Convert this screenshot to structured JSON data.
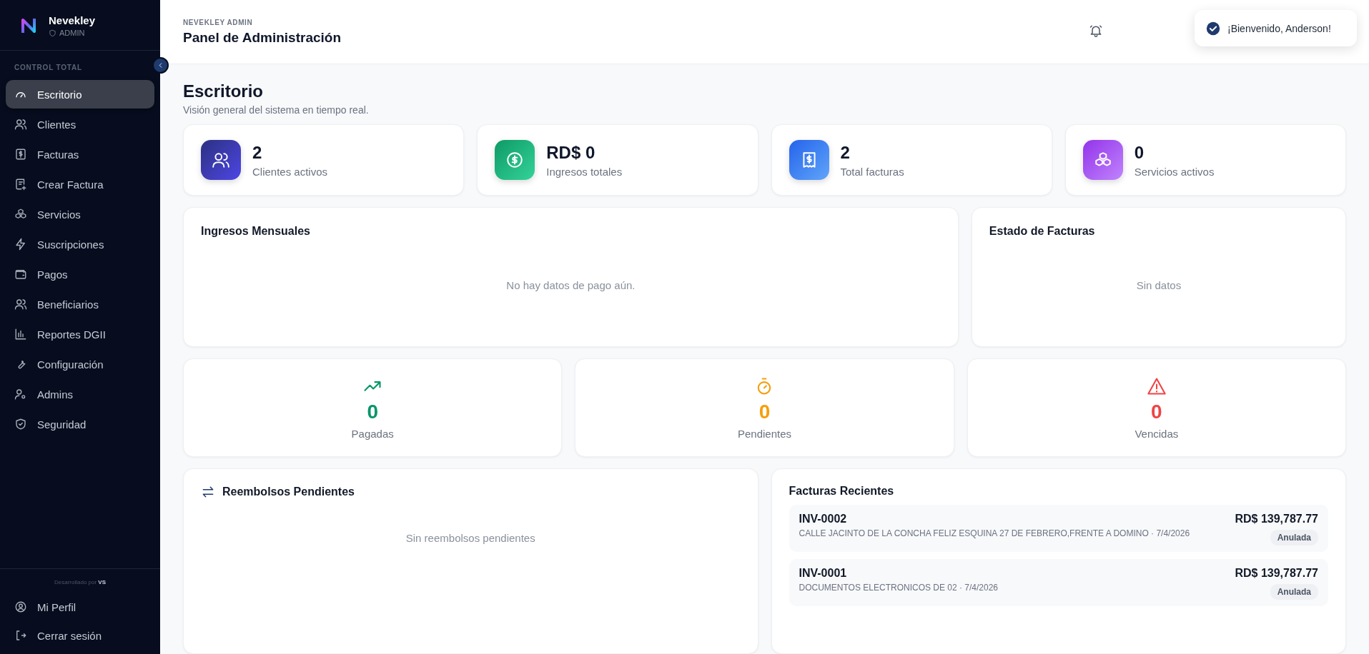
{
  "sidebar": {
    "brand": "Nevekley",
    "role": "ADMIN",
    "section": "CONTROL TOTAL",
    "items": [
      {
        "label": "Escritorio",
        "selected": true
      },
      {
        "label": "Clientes",
        "selected": false
      },
      {
        "label": "Facturas",
        "selected": false
      },
      {
        "label": "Crear Factura",
        "selected": false
      },
      {
        "label": "Servicios",
        "selected": false
      },
      {
        "label": "Suscripciones",
        "selected": false
      },
      {
        "label": "Pagos",
        "selected": false
      },
      {
        "label": "Beneficiarios",
        "selected": false
      },
      {
        "label": "Reportes DGII",
        "selected": false
      },
      {
        "label": "Configuración",
        "selected": false
      },
      {
        "label": "Admins",
        "selected": false
      },
      {
        "label": "Seguridad",
        "selected": false
      }
    ],
    "credit": "Desarrollado por **VS**",
    "footer_items": [
      {
        "label": "Mi Perfil"
      },
      {
        "label": "Cerrar sesión"
      }
    ]
  },
  "header": {
    "eyebrow": "NEVEKLEY ADMIN",
    "title": "Panel de Administración"
  },
  "toast": {
    "message": "¡Bienvenido, Anderson!"
  },
  "page": {
    "title": "Escritorio",
    "subtitle": "Visión general del sistema en tiempo real."
  },
  "stats": [
    {
      "value": "2",
      "label": "Clientes activos"
    },
    {
      "value": "RD$ 0",
      "label": "Ingresos totales"
    },
    {
      "value": "2",
      "label": "Total facturas"
    },
    {
      "value": "0",
      "label": "Servicios activos"
    }
  ],
  "panels": [
    {
      "title": "Ingresos Mensuales",
      "empty": "No hay datos de pago aún."
    },
    {
      "title": "Estado de Facturas",
      "empty": "Sin datos"
    }
  ],
  "status_cards": [
    {
      "value": "0",
      "label": "Pagadas",
      "color": "#059669"
    },
    {
      "value": "0",
      "label": "Pendientes",
      "color": "#f59e0b"
    },
    {
      "value": "0",
      "label": "Vencidas",
      "color": "#ef4444"
    }
  ],
  "refunds": {
    "title": "Reembolsos Pendientes",
    "empty": "Sin reembolsos pendientes"
  },
  "recent_invoices": {
    "title": "Facturas Recientes",
    "rows": [
      {
        "number": "INV-0002",
        "detail": "CALLE JACINTO DE LA CONCHA FELIZ ESQUINA 27 DE FEBRERO,FRENTE A DOMINO · 7/4/2026",
        "amount": "RD$ 139,787.77",
        "status": "Anulada"
      },
      {
        "number": "INV-0001",
        "detail": "DOCUMENTOS ELECTRONICOS DE 02 · 7/4/2026",
        "amount": "RD$ 139,787.77",
        "status": "Anulada"
      }
    ]
  }
}
